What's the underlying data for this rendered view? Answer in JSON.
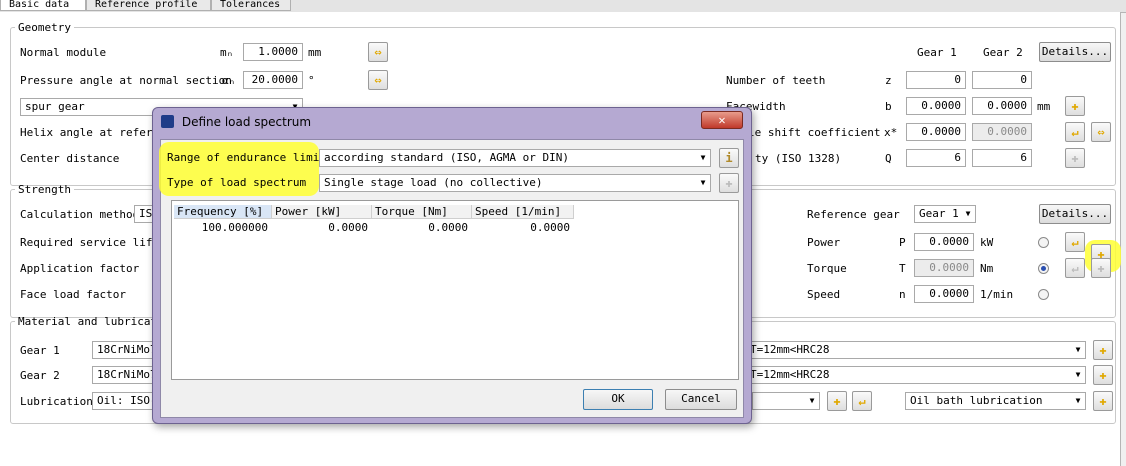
{
  "tabs": [
    "Basic data",
    "Reference profile",
    "Tolerances"
  ],
  "geometry": {
    "title": "Geometry",
    "normal_module": {
      "label": "Normal module",
      "symbol": "mₙ",
      "value": "1.0000",
      "unit": "mm"
    },
    "pressure_angle": {
      "label": "Pressure angle at normal section",
      "symbol": "αₙ",
      "value": "20.0000",
      "unit": "°"
    },
    "gear_type": "spur gear",
    "helix_angle": {
      "label": "Helix angle at referen"
    },
    "center_distance": {
      "label": "Center distance"
    },
    "gear1_header": "Gear 1",
    "gear2_header": "Gear 2",
    "details_label": "Details...",
    "number_of_teeth": {
      "label": "Number of teeth",
      "symbol": "z",
      "g1": "0",
      "g2": "0"
    },
    "facewidth": {
      "label": "Facewidth",
      "symbol": "b",
      "g1": "0.0000",
      "g2": "0.0000",
      "unit": "mm"
    },
    "profile_shift": {
      "label": "le shift coefficient",
      "symbol": "x*",
      "g1": "0.0000",
      "g2": "0.0000"
    },
    "quality": {
      "label": "ty (ISO 1328)",
      "symbol": "Q",
      "g1": "6",
      "g2": "6"
    }
  },
  "strength": {
    "title": "Strength",
    "calc_method_label": "Calculation method",
    "calc_method_value": "IS",
    "service_life_label": "Required service life",
    "application_factor_label": "Application factor",
    "face_load_label": "Face load factor",
    "reference_gear_label": "Reference gear",
    "reference_gear_value": "Gear 1",
    "details_label": "Details...",
    "power": {
      "label": "Power",
      "symbol": "P",
      "value": "0.0000",
      "unit": "kW"
    },
    "torque": {
      "label": "Torque",
      "symbol": "T",
      "value": "0.0000",
      "unit": "Nm"
    },
    "speed": {
      "label": "Speed",
      "symbol": "n",
      "value": "0.0000",
      "unit": "1/min"
    }
  },
  "material": {
    "title": "Material and lubricati",
    "gear1_label": "Gear 1",
    "gear1_left": "18CrNiMo7",
    "gear1_right": "T=12mm<HRC28",
    "gear2_label": "Gear 2",
    "gear2_left": "18CrNiMo7",
    "gear2_right": "T=12mm<HRC28",
    "lubrication_label": "Lubrication",
    "lubrication_left": "Oil: ISO-",
    "lubrication_type": "Oil bath lubrication"
  },
  "dialog": {
    "title": "Define load spectrum",
    "range_label": "Range of endurance limit",
    "range_value": "according standard (ISO, AGMA or DIN)",
    "type_label": "Type of load spectrum",
    "type_value": "Single stage load (no collective)",
    "columns": [
      "Frequency [%]",
      "Power [kW]",
      "Torque [Nm]",
      "Speed [1/min]"
    ],
    "rows": [
      [
        "100.000000",
        "0.0000",
        "0.0000",
        "0.0000"
      ]
    ],
    "ok_label": "OK",
    "cancel_label": "Cancel"
  },
  "colors": {
    "highlight": "#ffff33",
    "dialog_frame": "#b5a9d2",
    "close_button": "#c0392b",
    "icon_yellow": "#f2c200"
  }
}
